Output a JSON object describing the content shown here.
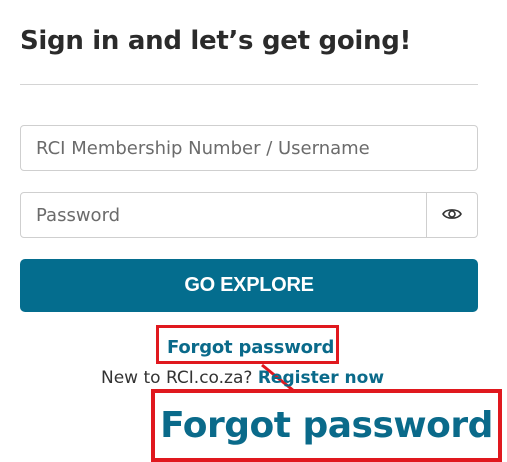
{
  "heading": "Sign in and let’s get going!",
  "username_field": {
    "placeholder": "RCI Membership Number / Username",
    "value": ""
  },
  "password_field": {
    "placeholder": "Password",
    "value": "",
    "toggle_icon": "eye-icon"
  },
  "primary_button": {
    "label": "GO EXPLORE",
    "color": "#046d8e"
  },
  "forgot_password": {
    "label": "Forgot password"
  },
  "register": {
    "prompt": "New to RCI.co.za?",
    "link_label": "Register now"
  },
  "zoom_callout": {
    "label": "Forgot password",
    "highlight_color": "#e0181e"
  }
}
